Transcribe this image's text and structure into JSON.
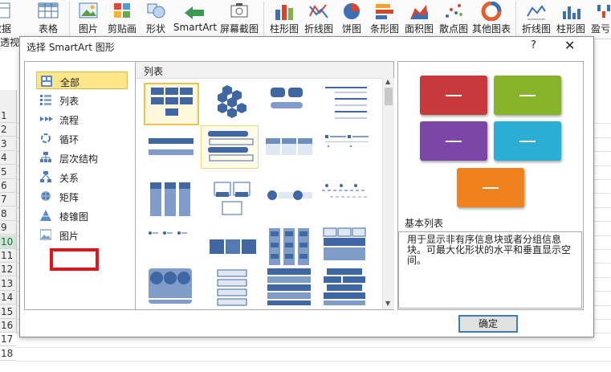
{
  "ribbon": {
    "items": [
      {
        "label": "数据",
        "icon": "pivot-table-icon"
      },
      {
        "label": "表格",
        "icon": "table-icon"
      },
      {
        "label": "图片",
        "icon": "picture-icon"
      },
      {
        "label": "剪贴画",
        "icon": "clip-art-icon"
      },
      {
        "label": "形状",
        "icon": "shapes-icon"
      },
      {
        "label": "SmartArt",
        "icon": "smartart-icon"
      },
      {
        "label": "屏幕截图",
        "icon": "screenshot-icon"
      },
      {
        "label": "柱形图",
        "icon": "column-chart-icon"
      },
      {
        "label": "折线图",
        "icon": "line-chart-icon"
      },
      {
        "label": "饼图",
        "icon": "pie-chart-icon"
      },
      {
        "label": "条形图",
        "icon": "bar-chart-icon"
      },
      {
        "label": "面积图",
        "icon": "area-chart-icon"
      },
      {
        "label": "散点图",
        "icon": "scatter-chart-icon"
      },
      {
        "label": "其他图表",
        "icon": "other-charts-icon"
      },
      {
        "label": "折线图",
        "icon": "sparkline-line-icon"
      },
      {
        "label": "柱形图",
        "icon": "sparkline-column-icon"
      },
      {
        "label": "盈亏",
        "icon": "sparkline-winloss-icon"
      }
    ],
    "partial_left_label": "透视表"
  },
  "sheet": {
    "rows": [
      "1",
      "2",
      "3",
      "4",
      "5",
      "6",
      "7",
      "8",
      "9",
      "10",
      "11",
      "12",
      "13",
      "14",
      "15",
      "16",
      "17",
      "18"
    ],
    "selected_row": "10"
  },
  "dialog": {
    "title": "选择 SmartArt 图形",
    "help": "?",
    "close": "✕",
    "categories": [
      {
        "label": "全部",
        "icon": "all-layouts-icon",
        "selected": true
      },
      {
        "label": "列表",
        "icon": "list-layout-icon"
      },
      {
        "label": "流程",
        "icon": "process-layout-icon"
      },
      {
        "label": "循环",
        "icon": "cycle-layout-icon"
      },
      {
        "label": "层次结构",
        "icon": "hierarchy-layout-icon"
      },
      {
        "label": "关系",
        "icon": "relationship-layout-icon"
      },
      {
        "label": "矩阵",
        "icon": "matrix-layout-icon"
      },
      {
        "label": "棱锥图",
        "icon": "pyramid-layout-icon"
      },
      {
        "label": "图片",
        "icon": "picture-layout-icon"
      }
    ],
    "gallery_header": "列表",
    "preview": {
      "title": "基本列表",
      "description": "用于显示非有序信息块或者分组信息块。可最大化形状的水平和垂直显示空间。",
      "colors": [
        "#c8393b",
        "#86b32a",
        "#7c45a8",
        "#2aaed6",
        "#f0821e"
      ]
    },
    "ok_label": "确定"
  }
}
